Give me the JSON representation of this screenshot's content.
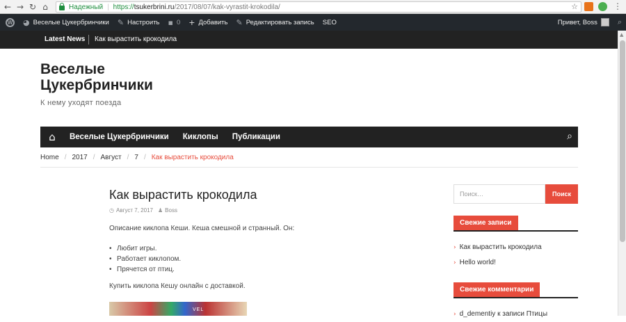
{
  "browser": {
    "secure_label": "Надежный",
    "url_scheme": "https://",
    "url_host": "tsukerbrini.ru",
    "url_path": "/2017/08/07/kak-vyrastit-krokodila/"
  },
  "adminbar": {
    "site_name": "Веселые Цукербринчики",
    "customize": "Настроить",
    "comments_count": "0",
    "add_new": "Добавить",
    "edit_post": "Редактировать запись",
    "seo": "SEO",
    "greeting": "Привет, Boss"
  },
  "newsbar": {
    "label": "Latest News",
    "headline": "Как вырастить крокодила"
  },
  "site": {
    "title": "Веселые Цукербринчики",
    "tagline": "К нему уходят поезда"
  },
  "mainnav": {
    "items": [
      "Веселые Цукербринчики",
      "Киклопы",
      "Публикации"
    ]
  },
  "breadcrumb": {
    "items": [
      "Home",
      "2017",
      "Август",
      "7"
    ],
    "current": "Как вырастить крокодила"
  },
  "post": {
    "title": "Как вырастить крокодила",
    "date": "Август 7, 2017",
    "author": "Boss",
    "intro": "Описание киклопа Кеши. Кеша смешной и странный. Он:",
    "list": [
      "Любит игры.",
      "Работает киклопом.",
      "Прячется от птиц."
    ],
    "outro": "Купить киклопа Кешу онлайн с доставкой.",
    "image_text": "VEL"
  },
  "sidebar": {
    "search_placeholder": "Поиск…",
    "search_button": "Поиск",
    "recent_posts_title": "Свежие записи",
    "recent_posts": [
      "Как вырастить крокодила",
      "Hello world!"
    ],
    "recent_comments_title": "Свежие комментарии",
    "recent_comment": "d_dementiy к записи Птицы"
  },
  "colors": {
    "accent": "#e74c3c",
    "dark": "#222222",
    "adminbar": "#23282d"
  }
}
